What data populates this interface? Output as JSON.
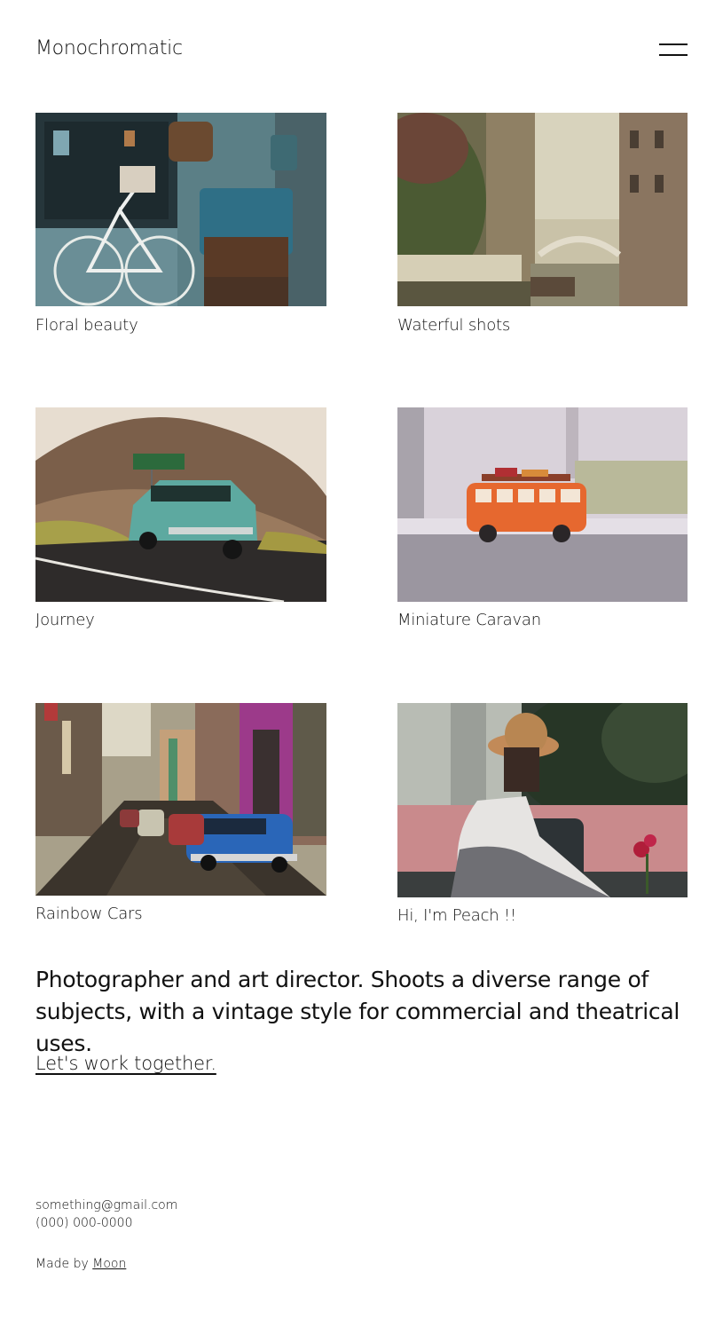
{
  "header": {
    "site_title": "Monochromatic",
    "menu_icon": "hamburger-menu-icon"
  },
  "gallery": [
    {
      "caption": "Floral beauty"
    },
    {
      "caption": "Waterful shots"
    },
    {
      "caption": "Journey"
    },
    {
      "caption": "Miniature Caravan"
    },
    {
      "caption": "Rainbow Cars"
    },
    {
      "caption": "Hi, I'm Peach !!"
    }
  ],
  "bio": {
    "text": "Photographer and art director. Shoots a diverse range of subjects, with a vintage style for commercial and theatrical uses.",
    "cta": "Let's work together."
  },
  "contact": {
    "email": "something@gmail.com",
    "phone": "(000) 000-0000"
  },
  "footer": {
    "made_by_prefix": "Made by",
    "author": "Moon"
  }
}
